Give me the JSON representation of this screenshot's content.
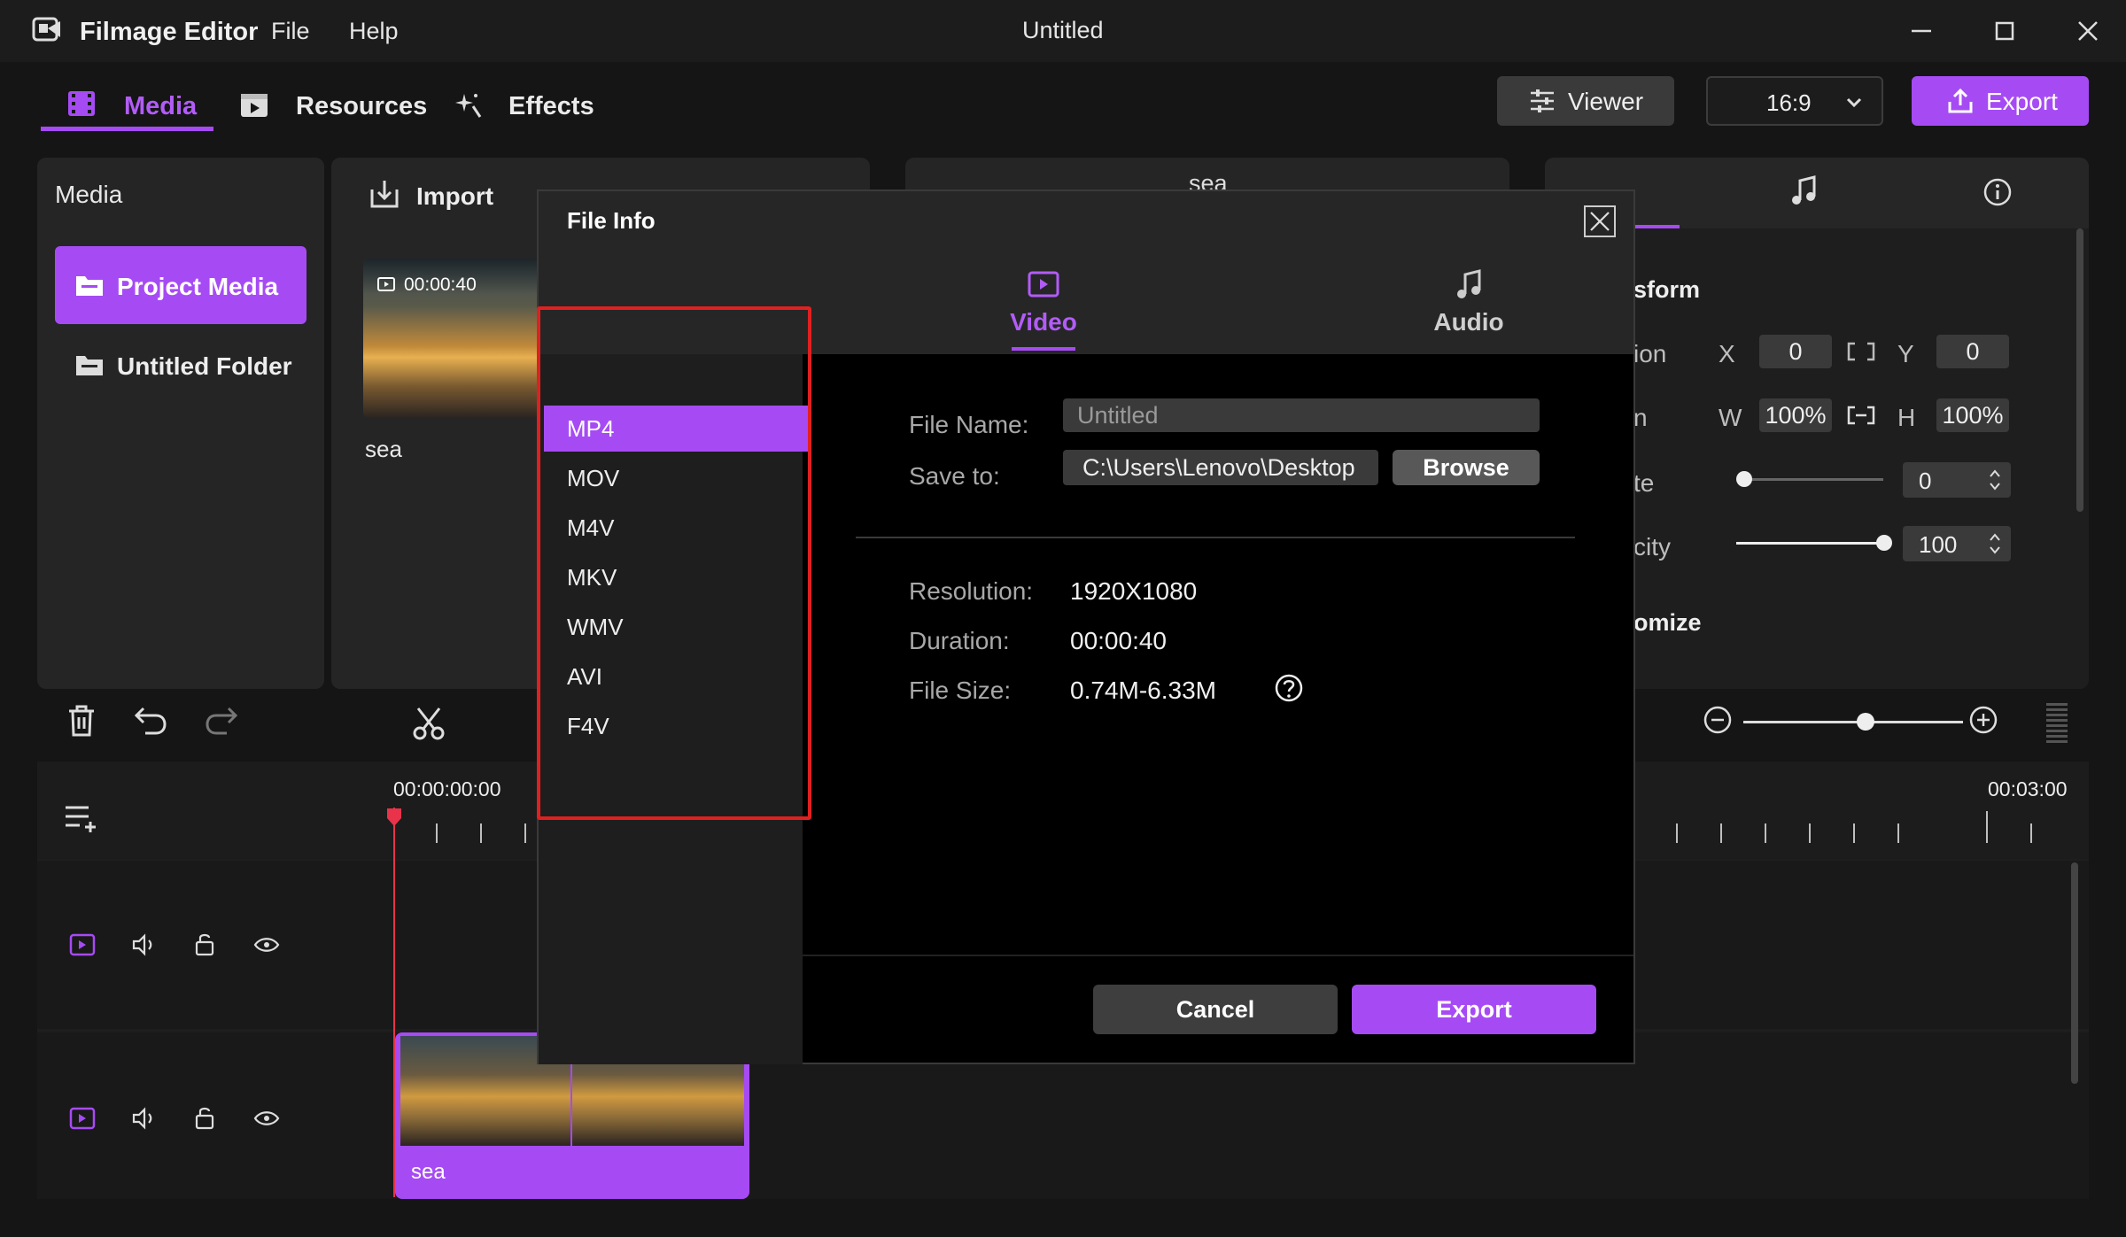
{
  "app": {
    "name": "Filmage Editor",
    "document_title": "Untitled"
  },
  "menu": {
    "file": "File",
    "help": "Help"
  },
  "tabs": [
    {
      "label": "Media",
      "active": true
    },
    {
      "label": "Resources"
    },
    {
      "label": "Effects"
    }
  ],
  "header": {
    "viewer": "Viewer",
    "ratio": "16:9",
    "export": "Export"
  },
  "media_panel": {
    "title": "Media",
    "project_media": "Project Media",
    "folder": "Untitled Folder"
  },
  "library": {
    "import": "Import",
    "clip_duration": "00:00:40",
    "clip_name": "sea"
  },
  "preview": {
    "title": "sea"
  },
  "inspector": {
    "transform_label": "sform",
    "position_label": "ion",
    "x_label": "X",
    "x": "0",
    "y_label": "Y",
    "y": "0",
    "scale_label": "n",
    "w_label": "W",
    "w": "100%",
    "h_label": "H",
    "h": "100%",
    "rotate_label": "te",
    "rotate": "0",
    "opacity_label": "city",
    "opacity": "100",
    "customize_label": "omize"
  },
  "timeline": {
    "start_time": "00:00:00:00",
    "end_time": "00:03:00",
    "clip_name": "sea"
  },
  "dialog": {
    "title": "File Info",
    "formats": [
      "MP4",
      "MOV",
      "M4V",
      "MKV",
      "WMV",
      "AVI",
      "F4V"
    ],
    "selected_format": "MP4",
    "tabs": {
      "video": "Video",
      "audio": "Audio"
    },
    "file_name_label": "File Name:",
    "file_name_placeholder": "Untitled",
    "save_to_label": "Save to:",
    "save_to": "C:\\Users\\Lenovo\\Desktop",
    "browse": "Browse",
    "resolution_label": "Resolution:",
    "resolution": "1920X1080",
    "duration_label": "Duration:",
    "duration": "00:00:40",
    "file_size_label": "File Size:",
    "file_size": "0.74M-6.33M",
    "cancel": "Cancel",
    "export": "Export"
  },
  "colors": {
    "accent": "#a64bf4",
    "highlight_box": "#e02020",
    "bg": "#151515"
  }
}
